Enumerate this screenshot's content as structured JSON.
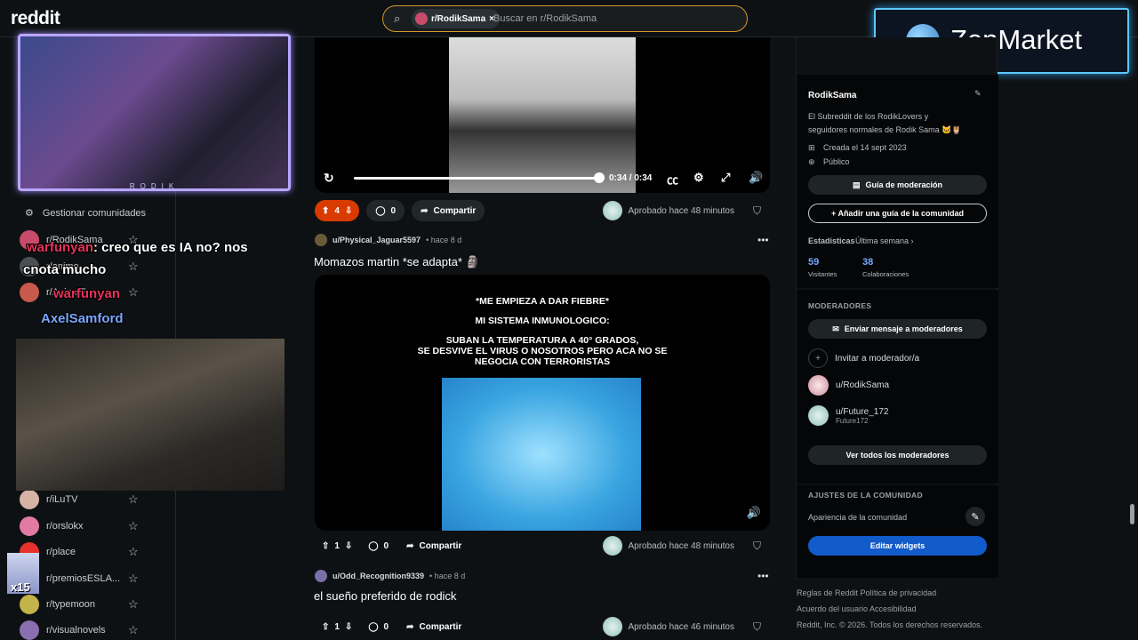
{
  "topbar": {
    "logo": "reddit",
    "search_chip": "r/RodikSama",
    "search_chip_close": "×",
    "search_placeholder": "Buscar en r/RodikSama"
  },
  "overlay": {
    "zenmarket": "ZenMarket",
    "cam_caption": "RODIK",
    "chat": [
      {
        "name": "warfunyan",
        "text": ": creo que es IA no? nos"
      },
      {
        "name": "",
        "text": "cnota mucho"
      },
      {
        "name": "warfunyan",
        "text": ""
      },
      {
        "name": "AxelSamford",
        "text": ""
      }
    ]
  },
  "sidebar": {
    "manage": "Gestionar comunidades",
    "communities_top": [
      "r/RodikSama",
      "r/anime",
      "r/AnimeFun"
    ],
    "communities": [
      "r/iLuTV",
      "r/orslokx",
      "r/place",
      "r/premiosESLA...",
      "r/typemoon",
      "r/visualnovels"
    ],
    "badge": "x15"
  },
  "video": {
    "time": "0:34 / 0:34"
  },
  "posts": [
    {
      "votes": "4",
      "comments": "0",
      "share": "Compartir",
      "approved": "Aprobado hace 48 minutos"
    },
    {
      "user": "u/Physical_Jaguar5597",
      "age": "• hace 8 d",
      "title": "Momazos martin *se adapta* 🗿",
      "media_text": [
        "*ME EMPIEZA A DAR FIEBRE*",
        "MI SISTEMA INMUNOLOGICO:",
        "SUBAN LA TEMPERATURA A 40° GRADOS,",
        "SE DESVIVE EL VIRUS O NOSOTROS PERO ACA NO SE",
        "NEGOCIA CON TERRORISTAS"
      ],
      "votes": "1",
      "comments": "0",
      "share": "Compartir",
      "approved": "Aprobado hace 48 minutos"
    },
    {
      "user": "u/Odd_Recognition9339",
      "age": "• hace 8 d",
      "title": "el sueño preferido de rodick",
      "votes": "1",
      "comments": "0",
      "share": "Compartir",
      "approved": "Aprobado hace 46 minutos"
    }
  ],
  "community": {
    "name": "RodikSama",
    "description": "El Subreddit de los RodikLovers y seguidores normales de Rodik Sama 🐱🦉",
    "created": "Creada el 14 sept 2023",
    "visibility": "Público",
    "guide_button": "Guía de moderación",
    "add_guide_button": "+ Añadir una guía de la comunidad",
    "stats_label": "Estadísticas",
    "stats_period": "Última semana ›",
    "visitors_value": "59",
    "visitors_label": "Visitantes",
    "contrib_value": "38",
    "contrib_label": "Colaboraciones"
  },
  "moderators": {
    "heading": "MODERADORES",
    "message_button": "Enviar mensaje a moderadores",
    "invite": "Invitar a moderador/a",
    "list": [
      {
        "name": "u/RodikSama",
        "sub": ""
      },
      {
        "name": "u/Future_172",
        "sub": "Future172"
      }
    ],
    "view_all": "Ver todos los moderadores"
  },
  "settings": {
    "heading": "AJUSTES DE LA COMUNIDAD",
    "appearance": "Apariencia de la comunidad",
    "edit_widgets": "Editar widgets"
  },
  "footer": {
    "line1": "Reglas de Reddit   Política de privacidad",
    "line2": "Acuerdo del usuario   Accesibilidad",
    "line3": "Reddit, Inc. © 2026. Todos los derechos reservados."
  },
  "colors": {
    "upvote_active": "#d93a00",
    "primary_button": "#115bca",
    "search_border": "#d39a2a"
  }
}
